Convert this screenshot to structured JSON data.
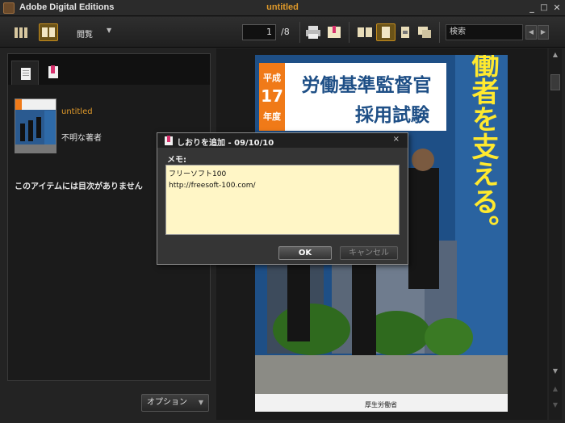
{
  "window": {
    "app_title": "Adobe Digital Editions",
    "doc_title": "untitled",
    "minimize": "_",
    "maximize": "□",
    "close": "✕"
  },
  "toolbar": {
    "view_mode_label": "閲覧",
    "view_caret": "▼",
    "current_page": "1",
    "total_pages": "/8",
    "search_placeholder": "検索",
    "prev": "◀",
    "next": "▶"
  },
  "library": {
    "item_title": "untitled",
    "item_author": "不明な著者",
    "no_toc_message": "このアイテムには目次がありません",
    "options_label": "オプション",
    "options_caret": "▼"
  },
  "page_content": {
    "header_left": "平成",
    "header_year": "17",
    "header_nendo": "年度",
    "title_line1": "労働基準監督官",
    "title_line2": "採用試験",
    "vertical_slogan": "すべての労働者を支える。",
    "footer": "厚生労働省"
  },
  "dialog": {
    "title": "しおりを追加 - 09/10/10",
    "close": "×",
    "memo_label": "メモ:",
    "memo_lines": [
      "フリーソフト100",
      "http://freesoft-100.com/"
    ],
    "ok_label": "OK",
    "cancel_label": "キャンセル"
  },
  "colors": {
    "accent": "#e09a2a",
    "page_blue": "#1e4f86",
    "memo_bg": "#fff6c6"
  }
}
